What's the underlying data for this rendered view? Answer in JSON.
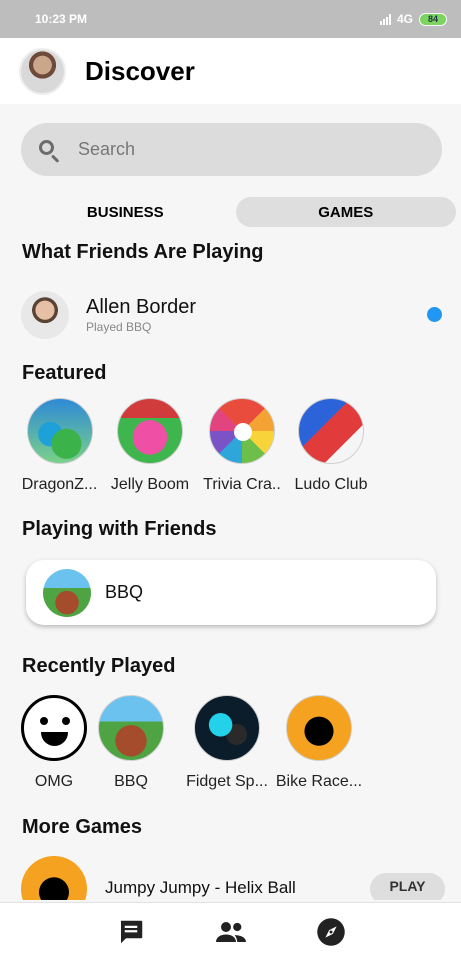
{
  "status_bar": {
    "time": "10:23 PM",
    "network": "4G",
    "battery": "84"
  },
  "header": {
    "title": "Discover"
  },
  "search": {
    "placeholder": "Search"
  },
  "tabs": [
    {
      "label": "BUSINESS",
      "active": false
    },
    {
      "label": "GAMES",
      "active": true
    }
  ],
  "friends_section": {
    "title": "What Friends Are Playing",
    "items": [
      {
        "name": "Allen Border",
        "activity": "Played BBQ",
        "online": true
      }
    ]
  },
  "featured": {
    "title": "Featured",
    "games": [
      {
        "label": "DragonZ...",
        "icon": "dragon-game-icon"
      },
      {
        "label": "Jelly Boom",
        "icon": "jelly-game-icon"
      },
      {
        "label": "Trivia Cra..",
        "icon": "trivia-game-icon"
      },
      {
        "label": "Ludo Club",
        "icon": "ludo-game-icon"
      }
    ]
  },
  "playing_with_friends": {
    "title": "Playing with Friends",
    "items": [
      {
        "label": "BBQ",
        "icon": "bbq-game-icon"
      }
    ]
  },
  "recently_played": {
    "title": "Recently Played",
    "games": [
      {
        "label": "OMG",
        "icon": "omg-game-icon"
      },
      {
        "label": "BBQ",
        "icon": "bbq-game-icon"
      },
      {
        "label": "Fidget Sp...",
        "icon": "fidget-game-icon"
      },
      {
        "label": "Bike Race...",
        "icon": "bike-game-icon"
      }
    ]
  },
  "more_games": {
    "title": "More Games",
    "items": [
      {
        "name": "Jumpy Jumpy - Helix Ball",
        "button": "PLAY"
      }
    ]
  },
  "bottom_nav": [
    {
      "icon": "chat-icon"
    },
    {
      "icon": "people-icon"
    },
    {
      "icon": "compass-icon"
    }
  ]
}
